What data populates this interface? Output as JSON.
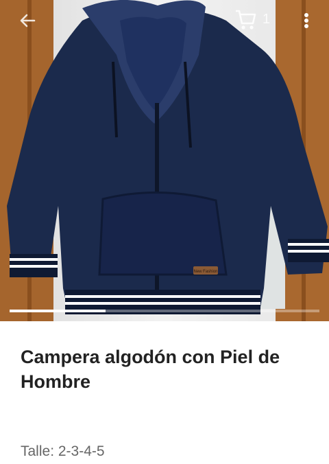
{
  "appbar": {
    "back_icon": "arrow-left-icon",
    "cart_icon": "cart-icon",
    "cart_count": "1",
    "more_icon": "more-vert-icon"
  },
  "hero": {
    "image": "navy-hooded-jacket-photo",
    "label_text": "New Fashion",
    "carousel_progress": 0.31
  },
  "product": {
    "title": "Campera algodón con Piel de Hombre",
    "sizes": "Talle: 2-3-4-5"
  },
  "colors": {
    "title": "#222222",
    "subtitle": "#666666",
    "jacket": "#1c2c4f"
  }
}
